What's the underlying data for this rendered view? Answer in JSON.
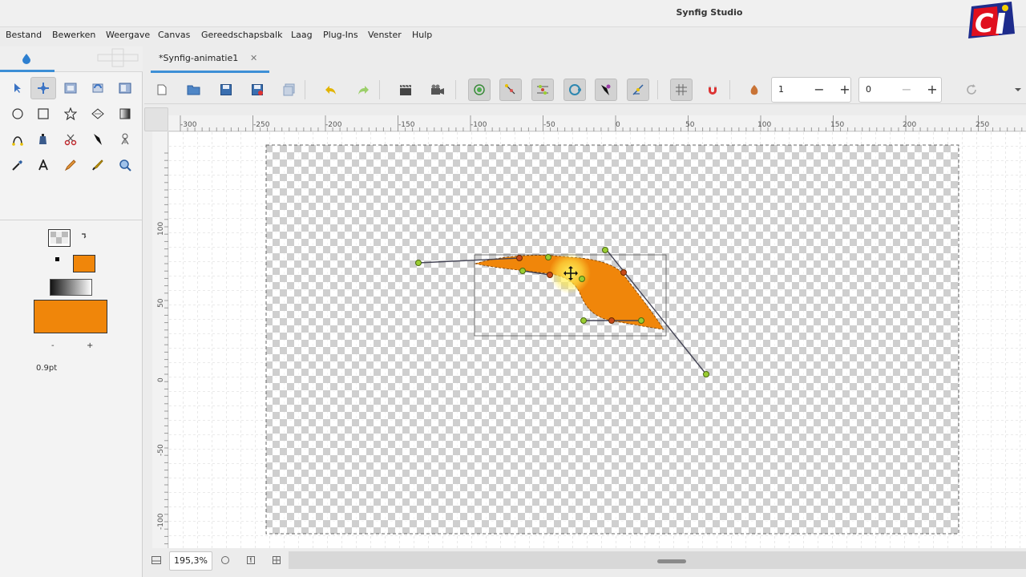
{
  "window": {
    "title": "Synfig Studio"
  },
  "menu": [
    "Bestand",
    "Bewerken",
    "Weergave",
    "Canvas",
    "Gereedschapsbalk",
    "Laag",
    "Plug-Ins",
    "Venster",
    "Hulp"
  ],
  "document": {
    "tab_label": "*Synfig-animatie1",
    "close_glyph": "✕"
  },
  "toolbar": {
    "frame_value": "1",
    "time_value": "0",
    "minus": "−",
    "plus": "+"
  },
  "ruler": {
    "top_labels": [
      "-300",
      "-250",
      "-200",
      "-150",
      "-100",
      "-50",
      "0",
      "50",
      "100",
      "150",
      "200",
      "250"
    ],
    "left_labels": [
      "100",
      "50",
      "0",
      "-50",
      "-100"
    ]
  },
  "panel": {
    "width_label": "0.9pt",
    "minus": "-",
    "plus": "+",
    "fill_color": "#f0860a",
    "outline_color": "#000000"
  },
  "status": {
    "zoom": "195,3%"
  },
  "colors": {
    "accent": "#3d8fd6",
    "shape_fill": "#f0860a",
    "handle": "#9acd32"
  }
}
